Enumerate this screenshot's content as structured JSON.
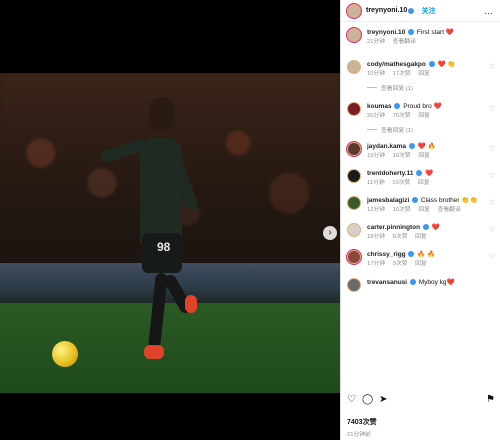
{
  "post": {
    "author": "treynyoni.10",
    "follow_label": "关注",
    "more_label": "…",
    "caption": {
      "user": "treynyoni.10",
      "text": "First start",
      "emoji": "❤️",
      "time": "21分钟",
      "translate": "查看翻译"
    },
    "player_number": "98",
    "comments": [
      {
        "user": "cody/mathesgakpo",
        "text": "❤️ 👏",
        "time": "10分钟",
        "likes": "17次赞",
        "reply": "回复",
        "view_replies": "查看回复 (1)"
      },
      {
        "user": "koumas",
        "text": "Proud bro ❤️",
        "time": "20分钟",
        "likes": "70次赞",
        "reply": "回复",
        "view_replies": "查看回复 (1)"
      },
      {
        "user": "jaydan.kama",
        "text": "❤️ 🔥",
        "time": "19分钟",
        "likes": "16次赞",
        "reply": "回复"
      },
      {
        "user": "trentdoherty.11",
        "text": "❤️",
        "time": "11分钟",
        "likes": "10次赞",
        "reply": "回复"
      },
      {
        "user": "jamesbalagizi",
        "text": "Class brother 👏👏",
        "time": "12分钟",
        "likes": "10次赞",
        "reply": "回复",
        "translate": "查看翻译"
      },
      {
        "user": "carter.pinnington",
        "text": "❤️",
        "time": "18分钟",
        "likes": "8次赞",
        "reply": "回复"
      },
      {
        "user": "chrissy_rigg",
        "text": "🔥 🔥",
        "time": "17分钟",
        "likes": "9次赞",
        "reply": "回复"
      },
      {
        "user": "trevansanusi",
        "text": "Myboy kg❤️",
        "time": "",
        "likes": "",
        "reply": ""
      }
    ],
    "likes_total": "7403次赞",
    "posted_ago": "21分钟前"
  },
  "icons": {
    "like": "heart-icon",
    "comment": "comment-icon",
    "share": "share-icon",
    "save": "bookmark-icon",
    "next": "chevron-right-icon"
  },
  "colors": {
    "follow": "#0095f6",
    "verified": "#3897f0",
    "carousel_active": "#3b82f6"
  }
}
